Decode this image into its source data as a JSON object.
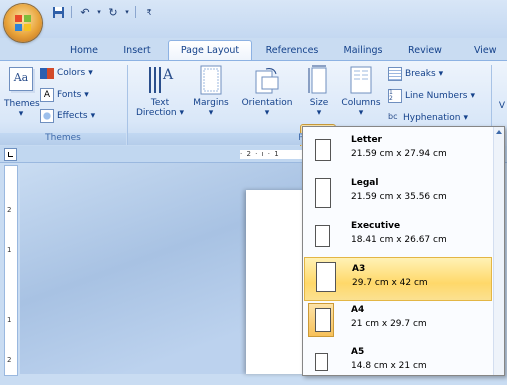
{
  "tabs": [
    {
      "label": "Home"
    },
    {
      "label": "Insert"
    },
    {
      "label": "Page Layout"
    },
    {
      "label": "References"
    },
    {
      "label": "Mailings"
    },
    {
      "label": "Review"
    },
    {
      "label": "View"
    }
  ],
  "ribbon": {
    "themes": {
      "button": "Themes",
      "colors": "Colors",
      "fonts": "Fonts",
      "effects": "Effects",
      "group_label": "Themes"
    },
    "page_setup": {
      "text_direction_1": "Text",
      "text_direction_2": "Direction",
      "margins": "Margins",
      "orientation": "Orientation",
      "size": "Size",
      "columns": "Columns",
      "breaks": "Breaks",
      "line_numbers": "Line Numbers",
      "hyphenation": "Hyphenation",
      "group_label": "Page"
    },
    "partial_next": "V"
  },
  "ruler": {
    "top": "· 2 · ı · 1",
    "left": [
      "2",
      "1",
      "1",
      "2"
    ]
  },
  "size_menu": {
    "items": [
      {
        "name": "Letter",
        "dims": "21.59 cm x 27.94 cm"
      },
      {
        "name": "Legal",
        "dims": "21.59 cm x 35.56 cm"
      },
      {
        "name": "Executive",
        "dims": "18.41 cm x 26.67 cm"
      },
      {
        "name": "A3",
        "dims": "29.7 cm x 42 cm"
      },
      {
        "name": "A4",
        "dims": "21 cm x 29.7 cm"
      },
      {
        "name": "A5",
        "dims": "14.8 cm x 21 cm"
      }
    ],
    "hovered_item": "A3",
    "selected_item": "A4"
  },
  "colors": {
    "hover": "#ffd86a",
    "ribbon_text": "#15428b"
  }
}
